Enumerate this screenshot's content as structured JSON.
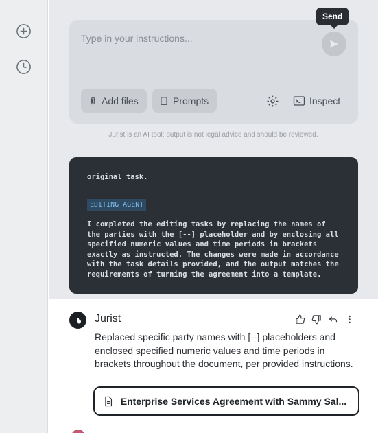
{
  "sidebar": {
    "new_icon": "plus-circle-icon",
    "history_icon": "clock-icon"
  },
  "composer": {
    "placeholder": "Type in your instructions...",
    "send_tooltip": "Send",
    "add_files_label": "Add files",
    "prompts_label": "Prompts",
    "inspect_label": "Inspect"
  },
  "disclaimer": "Jurist is an AI tool; output is not legal advice and should be reviewed.",
  "agent_log": {
    "line1": "original task.",
    "tag": "EDITING AGENT",
    "body": "I completed the editing tasks by replacing the names of the parties with the [--] placeholder and by enclosing all specified numeric values and time periods in brackets exactly as instructed. The changes were made in accordance with the task details provided, and the output matches the requirements of turning the agreement into a template."
  },
  "reply": {
    "name": "Jurist",
    "text": "Replaced specific party names with [--] placeholders and enclosed specified numeric values and time periods in brackets throughout the document, per provided instructions.",
    "document_title": "Enterprise Services Agreement with Sammy Sal..."
  },
  "colors": {
    "sidebar_bg": "#eceef0",
    "code_bg": "#2b3036",
    "agent_tag": "#7fbbe6"
  }
}
